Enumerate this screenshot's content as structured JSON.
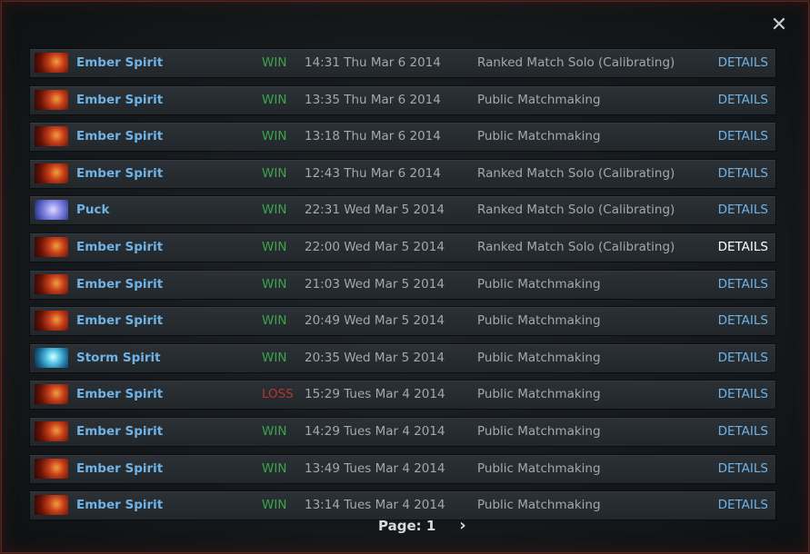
{
  "close_icon": "close-icon",
  "colors": {
    "win": "#3fa34b",
    "loss": "#b8352c",
    "link": "#6fb3e6"
  },
  "matches": [
    {
      "hero": "Ember Spirit",
      "icon": "ember",
      "result": "WIN",
      "time": "14:31 Thu Mar 6 2014",
      "mode": "Ranked Match Solo (Calibrating)",
      "details": "DETAILS"
    },
    {
      "hero": "Ember Spirit",
      "icon": "ember",
      "result": "WIN",
      "time": "13:35 Thu Mar 6 2014",
      "mode": "Public Matchmaking",
      "details": "DETAILS"
    },
    {
      "hero": "Ember Spirit",
      "icon": "ember",
      "result": "WIN",
      "time": "13:18 Thu Mar 6 2014",
      "mode": "Public Matchmaking",
      "details": "DETAILS"
    },
    {
      "hero": "Ember Spirit",
      "icon": "ember",
      "result": "WIN",
      "time": "12:43 Thu Mar 6 2014",
      "mode": "Ranked Match Solo (Calibrating)",
      "details": "DETAILS"
    },
    {
      "hero": "Puck",
      "icon": "puck",
      "result": "WIN",
      "time": "22:31 Wed Mar 5 2014",
      "mode": "Ranked Match Solo (Calibrating)",
      "details": "DETAILS"
    },
    {
      "hero": "Ember Spirit",
      "icon": "ember",
      "result": "WIN",
      "time": "22:00 Wed Mar 5 2014",
      "mode": "Ranked Match Solo (Calibrating)",
      "details": "DETAILS",
      "hovered": true
    },
    {
      "hero": "Ember Spirit",
      "icon": "ember",
      "result": "WIN",
      "time": "21:03 Wed Mar 5 2014",
      "mode": "Public Matchmaking",
      "details": "DETAILS"
    },
    {
      "hero": "Ember Spirit",
      "icon": "ember",
      "result": "WIN",
      "time": "20:49 Wed Mar 5 2014",
      "mode": "Public Matchmaking",
      "details": "DETAILS"
    },
    {
      "hero": "Storm Spirit",
      "icon": "storm",
      "result": "WIN",
      "time": "20:35 Wed Mar 5 2014",
      "mode": "Public Matchmaking",
      "details": "DETAILS"
    },
    {
      "hero": "Ember Spirit",
      "icon": "ember",
      "result": "LOSS",
      "time": "15:29 Tues Mar 4 2014",
      "mode": "Public Matchmaking",
      "details": "DETAILS"
    },
    {
      "hero": "Ember Spirit",
      "icon": "ember",
      "result": "WIN",
      "time": "14:29 Tues Mar 4 2014",
      "mode": "Public Matchmaking",
      "details": "DETAILS"
    },
    {
      "hero": "Ember Spirit",
      "icon": "ember",
      "result": "WIN",
      "time": "13:49 Tues Mar 4 2014",
      "mode": "Public Matchmaking",
      "details": "DETAILS"
    },
    {
      "hero": "Ember Spirit",
      "icon": "ember",
      "result": "WIN",
      "time": "13:14 Tues Mar 4 2014",
      "mode": "Public Matchmaking",
      "details": "DETAILS"
    }
  ],
  "pager": {
    "label": "Page: 1",
    "next_icon": "chevron-right-icon",
    "next_glyph": "›"
  }
}
